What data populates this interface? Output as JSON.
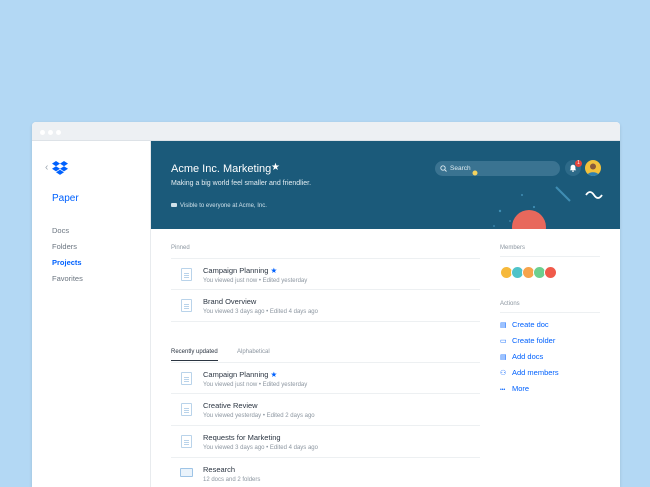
{
  "sidebar": {
    "back_glyph": "‹",
    "app_name": "Paper",
    "items": [
      {
        "label": "Docs",
        "active": false
      },
      {
        "label": "Folders",
        "active": false
      },
      {
        "label": "Projects",
        "active": true
      },
      {
        "label": "Favorites",
        "active": false
      }
    ]
  },
  "header": {
    "title": "Acme Inc. Marketing",
    "subtitle": "Making a big world feel smaller and friendlier.",
    "visibility": "Visible to everyone at Acme, Inc.",
    "search_placeholder": "Search",
    "notification_count": "1",
    "star_glyph": "★"
  },
  "pinned": {
    "label": "Pinned",
    "items": [
      {
        "title": "Campaign Planning",
        "starred": true,
        "meta": "You viewed just now • Edited yesterday",
        "icon": "doc-icon"
      },
      {
        "title": "Brand Overview",
        "starred": false,
        "meta": "You viewed 3 days ago • Edited 4 days ago",
        "icon": "doc-icon"
      }
    ]
  },
  "tabs": [
    {
      "label": "Recently updated",
      "active": true
    },
    {
      "label": "Alphabetical",
      "active": false
    }
  ],
  "recent": {
    "items": [
      {
        "title": "Campaign Planning",
        "starred": true,
        "meta": "You viewed just now • Edited yesterday",
        "icon": "doc-icon"
      },
      {
        "title": "Creative Review",
        "starred": false,
        "meta": "You viewed yesterday • Edited 2 days ago",
        "icon": "doc-icon"
      },
      {
        "title": "Requests for Marketing",
        "starred": false,
        "meta": "You viewed 3 days ago • Edited 4 days ago",
        "icon": "doc-icon"
      },
      {
        "title": "Research",
        "starred": false,
        "meta": "12 docs and 2 folders",
        "icon": "folder-icon"
      }
    ]
  },
  "members": {
    "label": "Members",
    "colors": [
      "#f6b93b",
      "#4fc3c9",
      "#f7a34b",
      "#6ccf8f",
      "#f05a4a"
    ]
  },
  "actions": {
    "label": "Actions",
    "items": [
      {
        "label": "Create doc",
        "icon": "doc-icon",
        "glyph": "▤"
      },
      {
        "label": "Create folder",
        "icon": "folder-icon",
        "glyph": "▭"
      },
      {
        "label": "Add docs",
        "icon": "add-doc-icon",
        "glyph": "▤"
      },
      {
        "label": "Add members",
        "icon": "add-member-icon",
        "glyph": "⚇"
      },
      {
        "label": "More",
        "icon": "more-icon",
        "glyph": "•••"
      }
    ]
  },
  "colors": {
    "background": "#b3d8f4",
    "header": "#1b5a7a",
    "accent": "#0061fe",
    "deco_coral": "#e8685c",
    "deco_yellow": "#f4d35e"
  }
}
